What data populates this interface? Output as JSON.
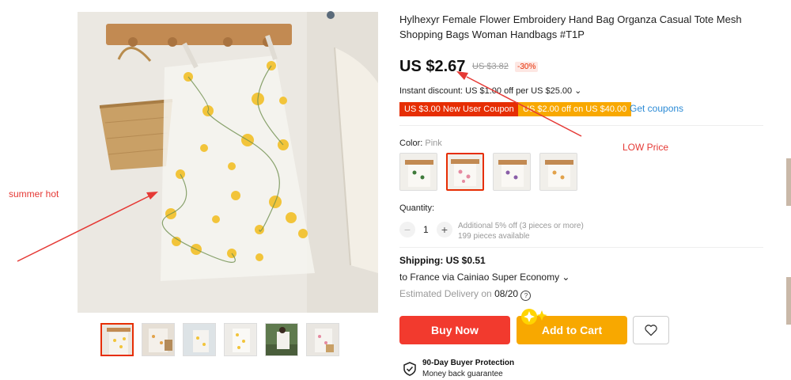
{
  "product": {
    "title": "Hylhexyr Female Flower Embroidery Hand Bag Organza Casual Tote Mesh Shopping Bags Woman Handbags #T1P",
    "price": "US $2.67",
    "original_price": "US $3.82",
    "discount": "-30%",
    "instant_discount": "Instant discount: US $1.00 off per US $25.00 ⌄",
    "coupons": [
      "US $3.00 New User Coupon",
      "US $2.00 off on US $40.00"
    ],
    "get_coupons": "Get coupons"
  },
  "color": {
    "label": "Color:",
    "selected": "Pink"
  },
  "quantity": {
    "label": "Quantity:",
    "value": "1",
    "minus": "−",
    "plus": "+",
    "additional": "Additional 5% off (3 pieces or more)",
    "available": "199 pieces available"
  },
  "shipping": {
    "label": "Shipping: US $0.51",
    "destination": "to France via Cainiao Super Economy ⌄",
    "delivery_prefix": "Estimated Delivery on",
    "delivery_date": "08/20"
  },
  "actions": {
    "buy_now": "Buy Now",
    "add_to_cart": "Add to Cart"
  },
  "protection": {
    "title": "90-Day Buyer Protection",
    "subtitle": "Money back guarantee"
  },
  "annotations": {
    "left": "summer hot",
    "right": "LOW Price"
  },
  "colors": {
    "accent_red": "#e62e04",
    "button_red": "#f23a2e",
    "button_orange": "#f8a800",
    "link_blue": "#2c8bd6",
    "annotation_red": "#e53935"
  }
}
